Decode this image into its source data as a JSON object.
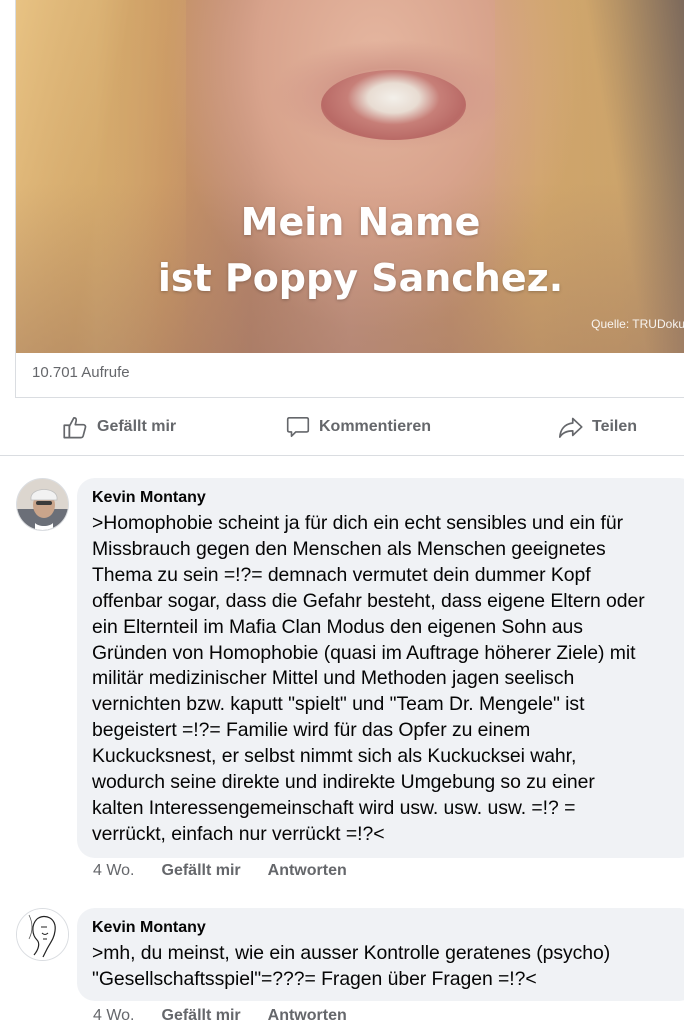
{
  "video": {
    "caption_line1": "Mein Name",
    "caption_line2": "ist Poppy Sanchez.",
    "source": "Quelle: TRUDoku",
    "views": "10.701 Aufrufe"
  },
  "actions": {
    "like": "Gefällt mir",
    "comment": "Kommentieren",
    "share": "Teilen"
  },
  "comments": [
    {
      "author": "Kevin Montany",
      "text": ">Homophobie scheint ja für dich ein echt sensibles und  ein für\nMissbrauch gegen den Menschen als Menschen geeignetes\nThema zu sein =!?= demnach vermutet dein dummer Kopf\noffenbar sogar, dass die Gefahr besteht, dass eigene Eltern oder\nein Elternteil im Mafia Clan Modus den eigenen Sohn aus\nGründen von Homophobie (quasi im Auftrage höherer Ziele) mit\nmilitär medizinischer Mittel und Methoden jagen seelisch\nvernichten bzw. kaputt \"spielt\" und \"Team Dr. Mengele\" ist\nbegeistert =!?= Familie wird für das Opfer zu einem\nKuckucksnest, er selbst nimmt sich als Kuckucksei wahr,\nwodurch seine direkte und indirekte  Umgebung so zu einer\nkalten  Interessengemeinschaft wird usw. usw. usw. =!? =\nverrückt, einfach nur verrückt =!?<",
      "time": "4 Wo.",
      "like": "Gefällt mir",
      "reply": "Antworten"
    },
    {
      "author": "Kevin Montany",
      "text": ">mh, du meinst, wie ein ausser Kontrolle geratenes (psycho)\n\"Gesellschaftsspiel\"=???= Fragen über Fragen =!?<",
      "time": "4 Wo.",
      "like": "Gefällt mir",
      "reply": "Antworten"
    }
  ],
  "icons": {
    "like": "thumbs-up-icon",
    "comment": "speech-bubble-icon",
    "share": "share-arrow-icon"
  }
}
